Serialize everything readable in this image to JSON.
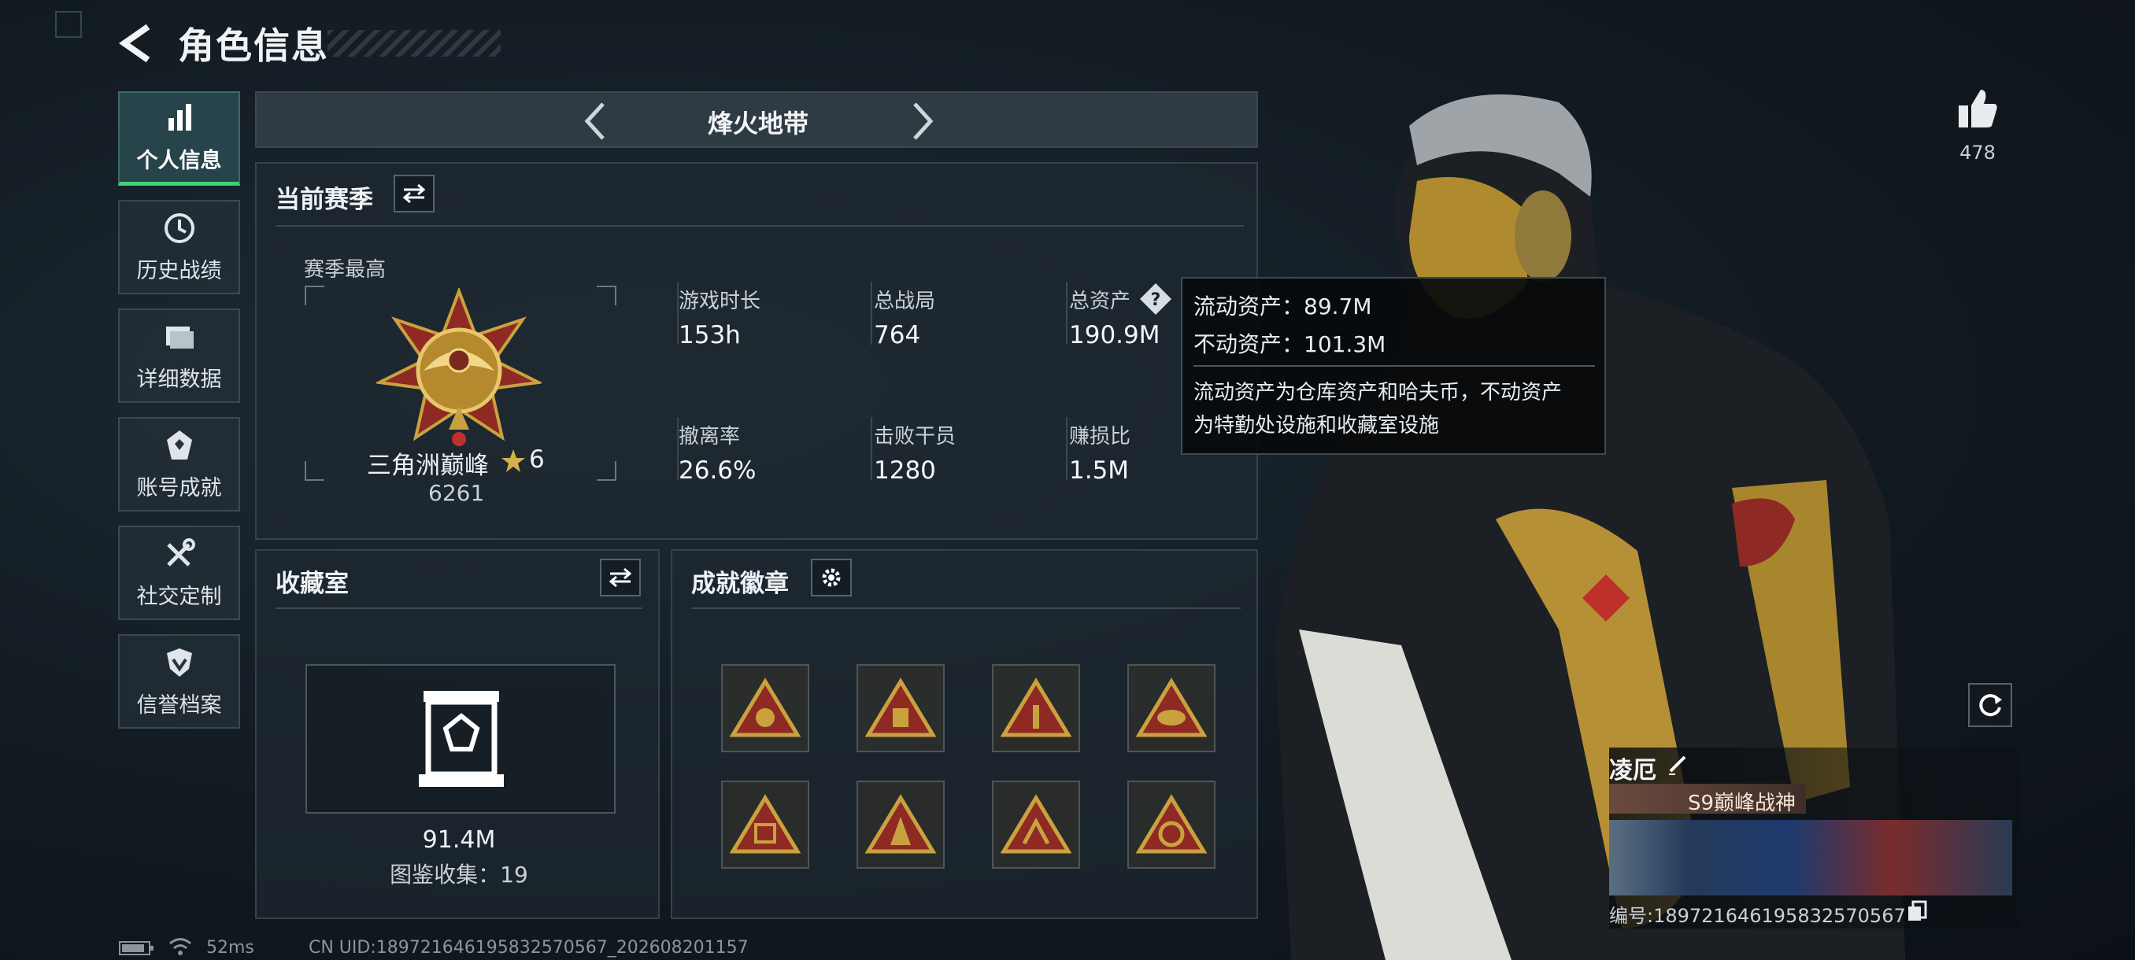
{
  "header": {
    "title": "角色信息"
  },
  "nav": [
    {
      "label": "个人信息",
      "icon": "bar-chart-icon",
      "active": true
    },
    {
      "label": "历史战绩",
      "icon": "history-clock-icon",
      "active": false
    },
    {
      "label": "详细数据",
      "icon": "folder-icon",
      "active": false
    },
    {
      "label": "账号成就",
      "icon": "achievement-icon",
      "active": false
    },
    {
      "label": "社交定制",
      "icon": "wrench-tools-icon",
      "active": false
    },
    {
      "label": "信誉档案",
      "icon": "shield-icon",
      "active": false
    }
  ],
  "mode": {
    "title": "烽火地带"
  },
  "season": {
    "title": "当前赛季",
    "best_label": "赛季最高",
    "rank_name": "三角洲巅峰",
    "rank_stars": "6",
    "rank_points": "6261",
    "stats": [
      {
        "label": "游戏时长",
        "value": "153h"
      },
      {
        "label": "总战局",
        "value": "764"
      },
      {
        "label": "总资产",
        "value": "190.9M"
      },
      {
        "label": "撤离率",
        "value": "26.6%"
      },
      {
        "label": "击败干员",
        "value": "1280"
      },
      {
        "label": "赚损比",
        "value": "1.5M"
      }
    ],
    "help_symbol": "?"
  },
  "tooltip": {
    "liquid": "流动资产：89.7M",
    "fixed": "不动资产：101.3M",
    "desc_line1": "流动资产为仓库资产和哈夫币，不动资产",
    "desc_line2": "为特勤处设施和收藏室设施"
  },
  "collection": {
    "title": "收藏室",
    "value": "91.4M",
    "catalog": "图鉴收集：19"
  },
  "achievements": {
    "title": "成就徽章",
    "badges": [
      "badge-1",
      "badge-2",
      "badge-3",
      "badge-4",
      "badge-5",
      "badge-6",
      "badge-7",
      "badge-8"
    ]
  },
  "player": {
    "likes": "478",
    "name": "凌厄",
    "title_tag": "S9巅峰战神",
    "id_line": "编号:18972164619583257056​7"
  },
  "status_bar": {
    "ping": "52ms",
    "uid": "CN UID:18972164619583257056​7_202608201157"
  },
  "colors": {
    "accent_green": "#3fd07a",
    "badge_gold": "#c9a23f",
    "badge_red": "#8e2a23"
  }
}
